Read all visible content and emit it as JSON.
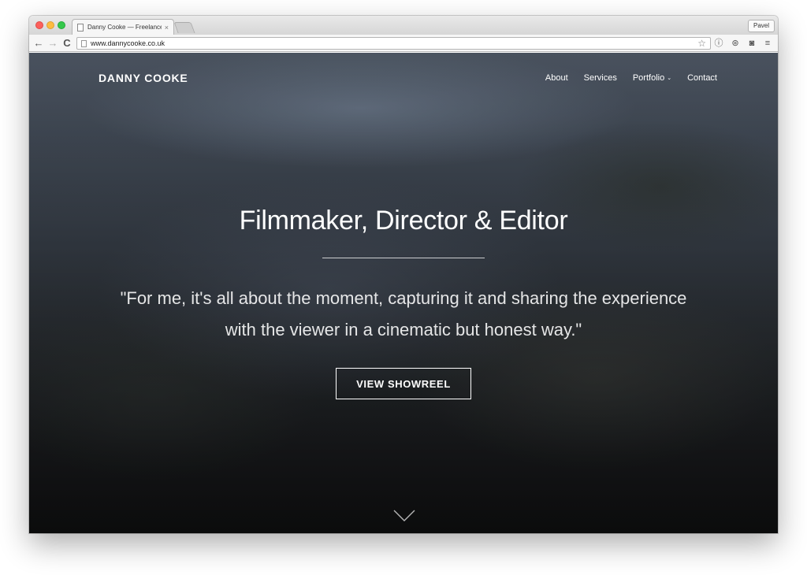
{
  "browser": {
    "tab_title": "Danny Cooke — Freelance",
    "tab_close": "×",
    "profile_name": "Pavel",
    "url": "www.dannycooke.co.uk",
    "icons": [
      "back-arrow-icon",
      "forward-arrow-icon",
      "reload-icon",
      "page-icon",
      "star-icon",
      "info-icon",
      "extension-icon",
      "camera-icon",
      "menu-icon"
    ]
  },
  "site": {
    "brand": "DANNY COOKE",
    "nav": [
      {
        "label": "About"
      },
      {
        "label": "Services"
      },
      {
        "label": "Portfolio",
        "chevron": "⌄"
      },
      {
        "label": "Contact"
      }
    ],
    "headline": "Filmmaker, Director & Editor",
    "quote_line1": "\"For me, it's all about the moment, capturing it and sharing the experience",
    "quote_line2": "with the viewer in a cinematic but honest way.\"",
    "cta_label": "VIEW SHOWREEL"
  },
  "colors": {
    "overlay_text": "#ffffff",
    "traffic_red": "#fc605c",
    "traffic_yellow": "#fdbc40",
    "traffic_green": "#34c84a"
  }
}
